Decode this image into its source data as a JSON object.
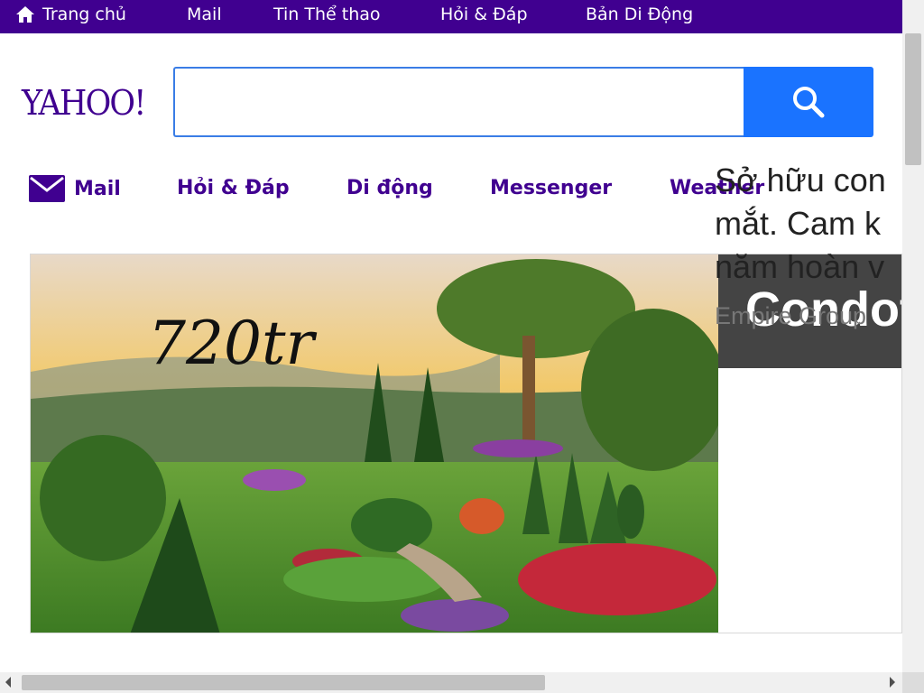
{
  "topbar": {
    "items": [
      {
        "label": "Trang chủ",
        "icon": "home-icon"
      },
      {
        "label": "Mail"
      },
      {
        "label": "Tin Thể thao"
      },
      {
        "label": "Hỏi & Đáp"
      },
      {
        "label": "Bản Di Động"
      }
    ],
    "background": "#400090"
  },
  "header": {
    "logo": "YAHOO!",
    "search": {
      "value": "",
      "placeholder": "",
      "button_icon": "search-icon"
    }
  },
  "nav": {
    "items": [
      {
        "label": "Mail",
        "icon": "mail-icon"
      },
      {
        "label": "Hỏi & Đáp"
      },
      {
        "label": "Di động"
      },
      {
        "label": "Messenger"
      },
      {
        "label": "Weather"
      }
    ],
    "color": "#400090"
  },
  "ad": {
    "overlay_text": "720tr",
    "title": "Condot",
    "description_lines": [
      "Sở hữu con",
      "mắt. Cam k",
      "năm hoàn v"
    ],
    "sponsor": "Empire Group"
  },
  "colors": {
    "accent": "#1a73ff",
    "brand": "#400090"
  }
}
